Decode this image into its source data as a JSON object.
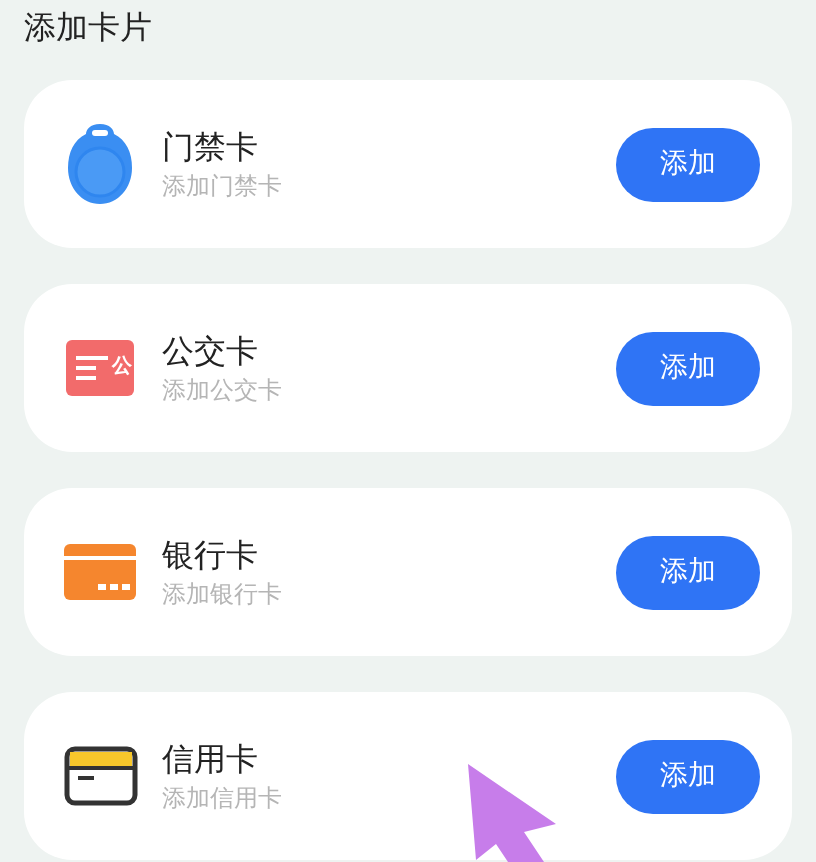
{
  "section_title": "添加卡片",
  "cards": [
    {
      "kind": "access",
      "name": "门禁卡",
      "subtitle": "添加门禁卡",
      "button": "添加"
    },
    {
      "kind": "transit",
      "name": "公交卡",
      "subtitle": "添加公交卡",
      "button": "添加",
      "icon_text": "公"
    },
    {
      "kind": "bank",
      "name": "银行卡",
      "subtitle": "添加银行卡",
      "button": "添加"
    },
    {
      "kind": "credit",
      "name": "信用卡",
      "subtitle": "添加信用卡",
      "button": "添加"
    }
  ]
}
